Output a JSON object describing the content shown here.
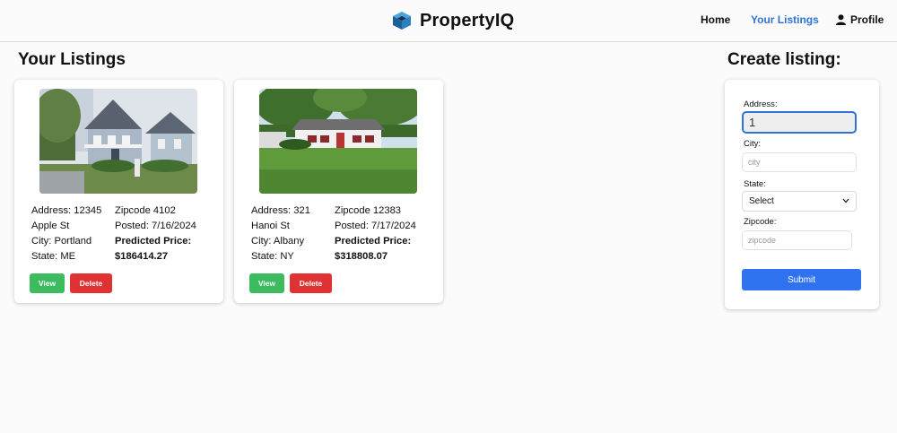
{
  "app": {
    "name": "PropertyIQ"
  },
  "nav": {
    "home": "Home",
    "listings": "Your Listings",
    "profile": "Profile"
  },
  "listings_title": "Your Listings",
  "listings": [
    {
      "address": "Address: 12345 Apple St",
      "city": "City: Portland",
      "state": "State: ME",
      "zipcode": "Zipcode 4102",
      "posted": "Posted: 7/16/2024",
      "predicted_label": "Predicted Price:",
      "predicted_price": "$186414.27",
      "view_label": "View",
      "delete_label": "Delete"
    },
    {
      "address": "Address: 321 Hanoi St",
      "city": "City: Albany",
      "state": "State: NY",
      "zipcode": "Zipcode 12383",
      "posted": "Posted: 7/17/2024",
      "predicted_label": "Predicted Price:",
      "predicted_price": "$318808.07",
      "view_label": "View",
      "delete_label": "Delete"
    }
  ],
  "form": {
    "title": "Create listing:",
    "address_label": "Address:",
    "address_value": "1",
    "city_label": "City:",
    "city_placeholder": "city",
    "state_label": "State:",
    "state_value": "Select",
    "zipcode_label": "Zipcode:",
    "zipcode_placeholder": "zipcode",
    "submit_label": "Submit"
  },
  "colors": {
    "accent": "#2f73d8",
    "view": "#3dbb5f",
    "delete": "#e03232",
    "submit": "#2f73f0"
  },
  "icons": {
    "brand": "cube-icon",
    "profile": "user-icon",
    "select": "chevron-down-icon"
  }
}
